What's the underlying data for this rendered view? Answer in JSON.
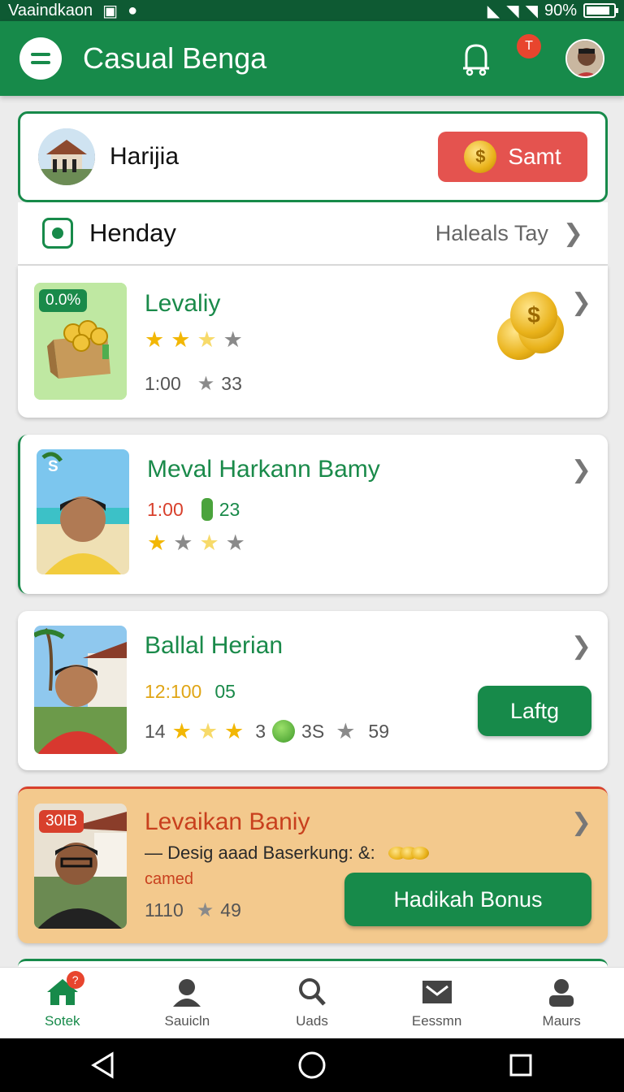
{
  "status_bar": {
    "carrier": "Vaaindkaon",
    "battery": "90%",
    "battery_level": 0.9
  },
  "app_bar": {
    "title": "Casual Benga",
    "notification_count": "T"
  },
  "profile": {
    "name": "Harijia",
    "button_label": "Samt"
  },
  "section": {
    "title": "Henday",
    "link_label": "Haleals Tay"
  },
  "cards": [
    {
      "title": "Levaliy",
      "badge": "0.0%",
      "line1": "1:00",
      "line1_value": "33",
      "rating": 2.5
    },
    {
      "title": "Meval Harkann Bamy",
      "badge": "S",
      "line1": "1:00",
      "line1_value": "23",
      "rating": 1.5
    },
    {
      "title": "Ballal Herian",
      "line1": "12:100",
      "line1_value": "05",
      "line2_a": "14",
      "line2_b": "3",
      "line2_c": "3S",
      "line2_d": "59",
      "button_label": "Laftg",
      "rating": 3
    },
    {
      "title": "Levaikan Baniy",
      "badge": "30IB",
      "subtitle": "— Desig aaad Baserkung: &:",
      "status": "camed",
      "line1": "1110",
      "line1_value": "49",
      "button_label": "Hadikah Bonus"
    }
  ],
  "bottom_nav": [
    {
      "label": "Sotek",
      "icon": "home-icon",
      "badge": "?"
    },
    {
      "label": "Sauicln",
      "icon": "person-icon"
    },
    {
      "label": "Uads",
      "icon": "search-icon"
    },
    {
      "label": "Eessmn",
      "icon": "mail-icon"
    },
    {
      "label": "Maurs",
      "icon": "profile-icon"
    }
  ],
  "colors": {
    "primary": "#178a4a",
    "dark_primary": "#0e5a33",
    "accent_red": "#e4534f",
    "highlight_card": "#f3c98d"
  }
}
